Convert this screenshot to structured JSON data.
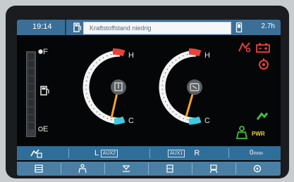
{
  "header": {
    "time": "19:14",
    "message": "Kraftstoffstand niedrig",
    "hours": "2.7h"
  },
  "fuel": {
    "full_label": "F",
    "empty_label": "E",
    "icon": "fuel-pump-icon"
  },
  "gauges": [
    {
      "name": "coolant-temperature",
      "hot_label": "H",
      "cold_label": "C",
      "level": 0.12,
      "icon": "coolant-temp-icon"
    },
    {
      "name": "hydraulic-oil-temperature",
      "hot_label": "H",
      "cold_label": "C",
      "level": 0.1,
      "icon": "hydraulic-oil-icon"
    }
  ],
  "warnings": {
    "colors": {
      "red": "#e8413a",
      "green": "#3fbf3a",
      "yellow": "#f2d23a"
    },
    "pwr_label": "PWR"
  },
  "softkeys": {
    "left_label": "L",
    "aux2": "AUX2",
    "aux1": "AUX1",
    "right_label": "R",
    "speed": "0",
    "speed_unit": "r/min"
  },
  "iconbar": [
    "grid-icon",
    "seat-icon",
    "filter-icon",
    "box-icon",
    "operator-icon",
    "camera-icon"
  ],
  "colors": {
    "bar_blue": "#2f6e98",
    "gauge_orange": "#f2a32a",
    "hot_red": "#e8413a",
    "cold_cyan": "#3cc9e0"
  }
}
